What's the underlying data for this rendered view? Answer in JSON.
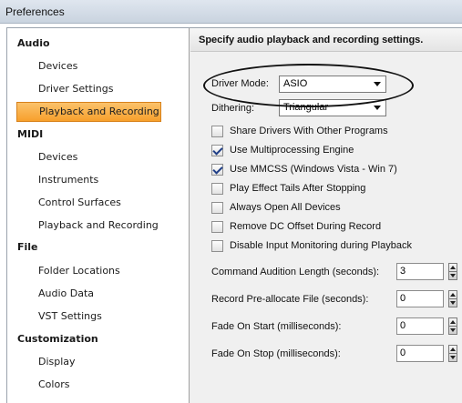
{
  "window": {
    "title": "Preferences"
  },
  "sidebar": {
    "groups": [
      {
        "label": "Audio",
        "items": [
          "Devices",
          "Driver Settings",
          "Playback and Recording"
        ]
      },
      {
        "label": "MIDI",
        "items": [
          "Devices",
          "Instruments",
          "Control Surfaces",
          "Playback and Recording"
        ]
      },
      {
        "label": "File",
        "items": [
          "Folder Locations",
          "Audio Data",
          "VST Settings"
        ]
      },
      {
        "label": "Customization",
        "items": [
          "Display",
          "Colors"
        ]
      }
    ],
    "selected": "Playback and Recording"
  },
  "panel": {
    "heading": "Specify audio playback and recording settings.",
    "driver_mode": {
      "label": "Driver Mode:",
      "value": "ASIO"
    },
    "dithering": {
      "label": "Dithering:",
      "value": "Triangular"
    },
    "checkboxes": [
      {
        "label": "Share Drivers With Other Programs",
        "checked": false
      },
      {
        "label": "Use Multiprocessing Engine",
        "checked": true
      },
      {
        "label": "Use MMCSS (Windows Vista - Win 7)",
        "checked": true
      },
      {
        "label": "Play Effect Tails After Stopping",
        "checked": false
      },
      {
        "label": "Always Open All Devices",
        "checked": false
      },
      {
        "label": "Remove DC Offset During Record",
        "checked": false
      },
      {
        "label": "Disable Input Monitoring during Playback",
        "checked": false
      }
    ],
    "numeric": [
      {
        "label": "Command Audition Length (seconds):",
        "value": "3"
      },
      {
        "label": "Record Pre-allocate File (seconds):",
        "value": "0"
      },
      {
        "label": "Fade On Start  (milliseconds):",
        "value": "0"
      },
      {
        "label": "Fade On Stop  (milliseconds):",
        "value": "0"
      }
    ]
  },
  "colors": {
    "selected_item": "#f7a02c",
    "checkmark": "#1f3e87"
  }
}
